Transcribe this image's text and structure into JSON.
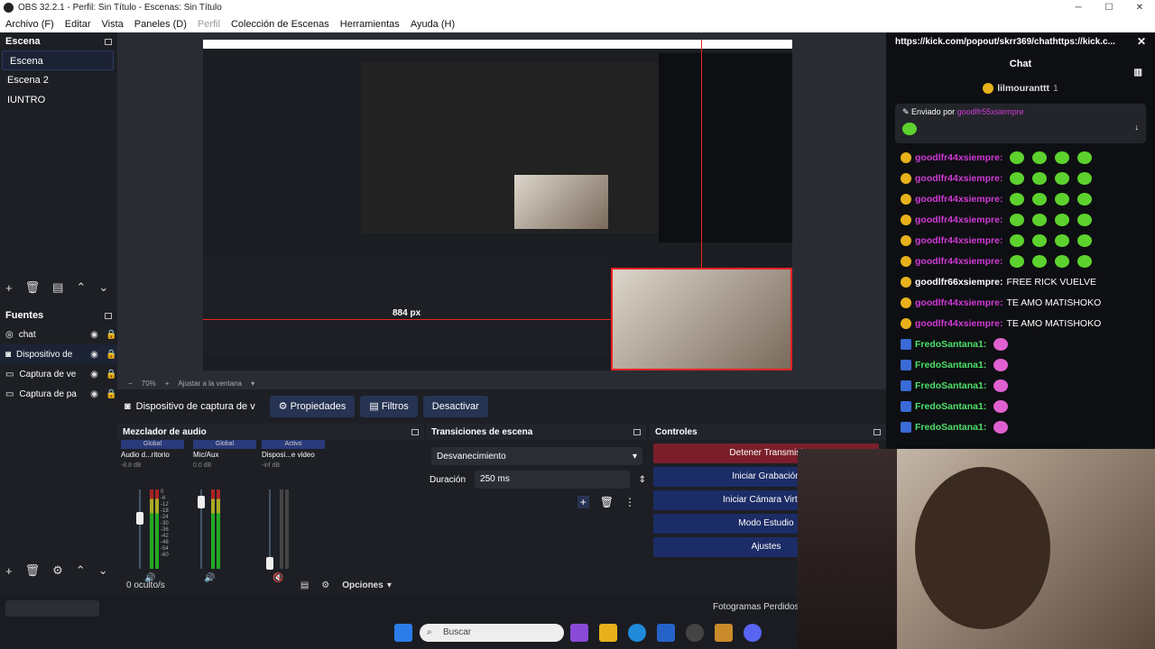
{
  "window": {
    "title": "OBS 32.2.1 - Perfil: Sin Título - Escenas: Sin Título"
  },
  "menu": [
    "Archivo (F)",
    "Editar",
    "Vista",
    "Paneles (D)",
    "Perfil",
    "Colección de Escenas",
    "Herramientas",
    "Ayuda (H)"
  ],
  "scenes": {
    "header": "Escena",
    "items": [
      "Escena",
      "Escena 2",
      "IUNTRO"
    ]
  },
  "sources": {
    "header": "Fuentes",
    "items": [
      "chat",
      "Dispositivo de",
      "Captura de ve",
      "Captura de pa"
    ]
  },
  "context": {
    "label": "Dispositivo de captura de v",
    "props": "Propiedades",
    "filters": "Filtros",
    "deactivate": "Desactivar"
  },
  "preview": {
    "zoom": "70%",
    "fit": "Ajustar a la ventana",
    "overlay": "884 px"
  },
  "mixer": {
    "header": "Mezclador de audio",
    "channels": [
      {
        "tag": "Global",
        "name": "Audio d...ritorio",
        "db": "-8.8 dB"
      },
      {
        "tag": "Global",
        "name": "Mic/Aux",
        "db": "0.0 dB"
      },
      {
        "tag": "Activo",
        "name": "Disposi...e video",
        "db": "-inf dB"
      }
    ],
    "scale": [
      "0",
      "-6",
      "-12",
      "-18",
      "-24",
      "-30",
      "-36",
      "-42",
      "-48",
      "-54",
      "-60"
    ]
  },
  "transitions": {
    "header": "Transiciones de escena",
    "type": "Desvanecimiento",
    "duration_label": "Duración",
    "duration": "250 ms"
  },
  "controls": {
    "header": "Controles",
    "buttons": [
      "Detener Transmisi",
      "Iniciar Grabación",
      "Iniciar Cámara Virtual",
      "Modo Estudio",
      "Ajustes"
    ]
  },
  "status": {
    "hidden": "0 oculto/s",
    "options": "Opciones",
    "frames": "Fotogramas Perdidos"
  },
  "taskbar": {
    "search": "Buscar"
  },
  "chat": {
    "url": "https://kick.com/popout/skrr369/chathttps://kick.c...",
    "title": "Chat",
    "top_user": "lilmouranttt",
    "top_count": "1",
    "pinned_prefix": "Enviado por",
    "pinned_user": "goodlfr55xsiempre",
    "messages": [
      {
        "user": "goodlfr44xsiempre:",
        "text": "",
        "color": "#d03ad6"
      },
      {
        "user": "goodlfr44xsiempre:",
        "text": "",
        "color": "#d03ad6"
      },
      {
        "user": "goodlfr44xsiempre:",
        "text": "",
        "color": "#d03ad6"
      },
      {
        "user": "goodlfr44xsiempre:",
        "text": "",
        "color": "#d03ad6"
      },
      {
        "user": "goodlfr44xsiempre:",
        "text": "",
        "color": "#d03ad6"
      },
      {
        "user": "goodlfr44xsiempre:",
        "text": "",
        "color": "#d03ad6"
      },
      {
        "user": "goodlfr66xsiempre:",
        "text": "FREE RICK VUELVE",
        "color": "#ffffff"
      },
      {
        "user": "goodlfr44xsiempre:",
        "text": "TE AMO MATISHOKO",
        "color": "#d03ad6"
      },
      {
        "user": "goodlfr44xsiempre:",
        "text": "TE AMO MATISHOKO",
        "color": "#d03ad6"
      },
      {
        "user": "FredoSantana1:",
        "text": "",
        "color": "#4de06a"
      },
      {
        "user": "FredoSantana1:",
        "text": "",
        "color": "#4de06a"
      },
      {
        "user": "FredoSantana1:",
        "text": "",
        "color": "#4de06a"
      },
      {
        "user": "FredoSantana1:",
        "text": "",
        "color": "#4de06a"
      },
      {
        "user": "FredoSantana1:",
        "text": "",
        "color": "#4de06a"
      }
    ]
  },
  "colors": {
    "accent": "#263352",
    "stop": "#7a1f2a",
    "control": "#1c2c66"
  }
}
